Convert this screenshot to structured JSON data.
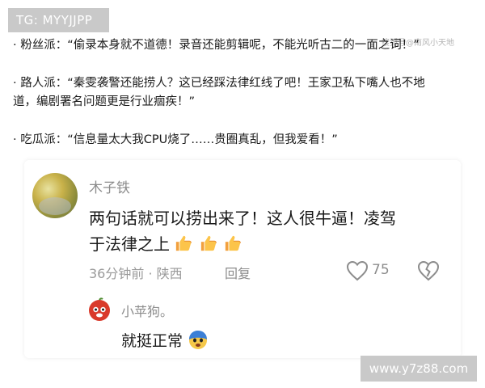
{
  "watermark": {
    "top_left": "TG: MYYJJPP",
    "top_right": "搜狐号@南风小天地",
    "bottom_right": "www.y7z88.com"
  },
  "opinions": [
    "· 粉丝派：“偷录本身就不道德！录音还能剪辑呢，不能光听古二的一面之词！”",
    "· 路人派：“秦雯袭警还能捞人？这已经踩法律红线了吧！王家卫私下嘴人也不地",
    "道，编剧署名问题更是行业痼疾！”",
    "· 吃瓜派：“信息量太大我CPU烧了……贵圈真乱，但我爱看！”"
  ],
  "comment": {
    "username": "木子铁",
    "line1": "两句话就可以捞出来了！这人很牛逼！凌驾",
    "line2": "于法律之上",
    "time_location": "36分钟前 · 陕西",
    "reply_label": "回复",
    "like_count": "75",
    "reply": {
      "username": "小苹狗。",
      "text": "就挺正常"
    }
  },
  "icons": {
    "like": "heart-icon",
    "dislike": "broken-heart-icon",
    "thumbs": "thumbs-up-icon",
    "avatar_reply": "apple-dog-icon",
    "emoji": "scared-face-icon"
  }
}
